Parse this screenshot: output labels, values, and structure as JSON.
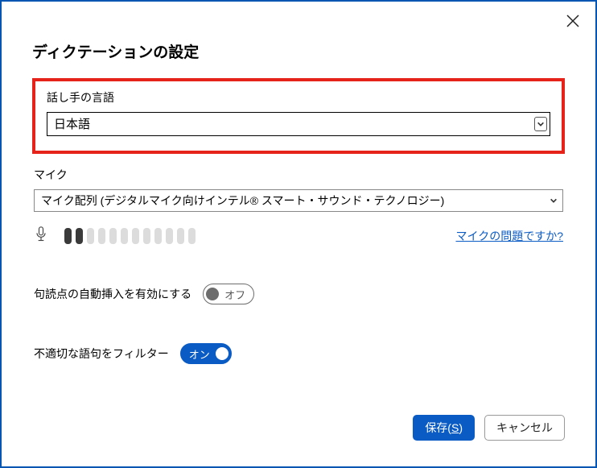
{
  "title": "ディクテーションの設定",
  "language": {
    "label": "話し手の言語",
    "value": "日本語"
  },
  "mic": {
    "label": "マイク",
    "value": "マイク配列 (デジタルマイク向けインテル® スマート・サウンド・テクノロジー)",
    "help": "マイクの問題ですか?",
    "level_active": 2,
    "level_total": 12
  },
  "auto_punct": {
    "label": "句読点の自動挿入を有効にする",
    "state_label": "オフ"
  },
  "profanity": {
    "label": "不適切な語句をフィルター",
    "state_label": "オン"
  },
  "buttons": {
    "save_prefix": "保存(",
    "save_mnemonic": "S",
    "save_suffix": ")",
    "cancel": "キャンセル"
  }
}
